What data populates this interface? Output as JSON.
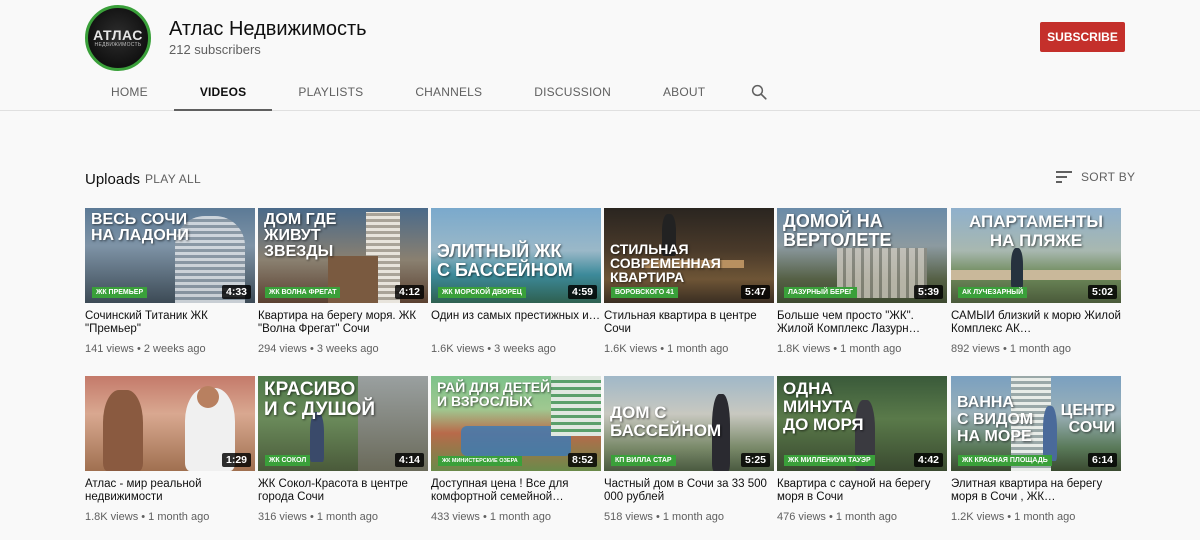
{
  "channel": {
    "name": "Атлас Недвижимость",
    "subscribers": "212 subscribers",
    "logo_text": "АТЛАС",
    "logo_subtext": "НЕДВИЖИМОСТЬ",
    "subscribe_label": "SUBSCRIBE"
  },
  "tabs": [
    {
      "label": "HOME"
    },
    {
      "label": "VIDEOS",
      "active": true
    },
    {
      "label": "PLAYLISTS"
    },
    {
      "label": "CHANNELS"
    },
    {
      "label": "DISCUSSION"
    },
    {
      "label": "ABOUT"
    }
  ],
  "shelf": {
    "title": "Uploads",
    "play_all": "PLAY ALL",
    "sort_label": "SORT BY"
  },
  "colors": {
    "subscribe": "#c4302b",
    "tag_green": "#3aa03a"
  },
  "videos": [
    {
      "title": "Сочинский Титаник ЖК \"Премьер\"",
      "meta": "141 views • 2 weeks ago",
      "duration": "4:33",
      "headline": "ВЕСЬ СОЧИ\nНА ЛАДОНИ",
      "tag": "ЖК ПРЕМЬЕР"
    },
    {
      "title": "Квартира на берегу моря. ЖК \"Волна Фрегат\" Сочи",
      "meta": "294 views • 3 weeks ago",
      "duration": "4:12",
      "headline": "ДОМ ГДЕ\nЖИВУТ\nЗВЕЗДЫ",
      "tag": "ЖК ВОЛНА ФРЕГАТ"
    },
    {
      "title": "Один из самых престижных и…",
      "meta": "1.6K views • 3 weeks ago",
      "duration": "4:59",
      "headline": "ЭЛИТНЫЙ ЖК\nС БАССЕЙНОМ",
      "tag": "ЖК МОРСКОЙ ДВОРЕЦ"
    },
    {
      "title": "Стильная квартира в центре Сочи",
      "meta": "1.6K views • 1 month ago",
      "duration": "5:47",
      "headline": "СТИЛЬНАЯ\nСОВРЕМЕННАЯ\nКВАРТИРА",
      "tag": "ВОРОВСКОГО 41"
    },
    {
      "title": "Больше чем просто \"ЖК\". Жилой Комплекс Лазурн…",
      "meta": "1.8K views • 1 month ago",
      "duration": "5:39",
      "headline": "ДОМОЙ НА\nВЕРТОЛЕТЕ",
      "tag": "ЛАЗУРНЫЙ БЕРЕГ"
    },
    {
      "title": "САМЫЙ близкий к морю Жилой Комплекс АК…",
      "meta": "892 views • 1 month ago",
      "duration": "5:02",
      "headline": "АПАРТАМЕНТЫ\nНА ПЛЯЖЕ",
      "tag": "АК ЛУЧЕЗАРНЫЙ"
    },
    {
      "title": "Атлас - мир реальной недвижимости",
      "meta": "1.8K views • 1 month ago",
      "duration": "1:29",
      "headline": "",
      "tag": ""
    },
    {
      "title": "ЖК Сокол-Красота в центре города Сочи",
      "meta": "316 views • 1 month ago",
      "duration": "4:14",
      "headline": "КРАСИВО\nИ С ДУШОЙ",
      "tag": "ЖК СОКОЛ"
    },
    {
      "title": "Доступная цена ! Все для комфортной семейной…",
      "meta": "433 views • 1 month ago",
      "duration": "8:52",
      "headline": "РАЙ ДЛЯ ДЕТЕЙ\nИ ВЗРОСЛЫХ",
      "tag": "ЖК МИНИСТЕРСКИЕ ОЗЕРА"
    },
    {
      "title": "Частный дом в Сочи за 33 500 000 рублей",
      "meta": "518 views • 1 month ago",
      "duration": "5:25",
      "headline": "ДОМ С\nБАССЕЙНОМ",
      "tag": "КП ВИЛЛА СТАР"
    },
    {
      "title": "Квартира с сауной на берегу моря в Сочи",
      "meta": "476 views • 1 month ago",
      "duration": "4:42",
      "headline": "ОДНА\nМИНУТА\nДО МОРЯ",
      "tag": "ЖК МИЛЛЕНИУМ ТАУЭР"
    },
    {
      "title": "Элитная квартира на берегу моря в Сочи , ЖК…",
      "meta": "1.2K views • 1 month ago",
      "duration": "6:14",
      "headline": "ВАННА\nС ВИДОМ\nНА МОРЕ",
      "headline_right": "ЦЕНТР\nСОЧИ",
      "tag": "ЖК КРАСНАЯ ПЛОЩАДЬ"
    }
  ]
}
